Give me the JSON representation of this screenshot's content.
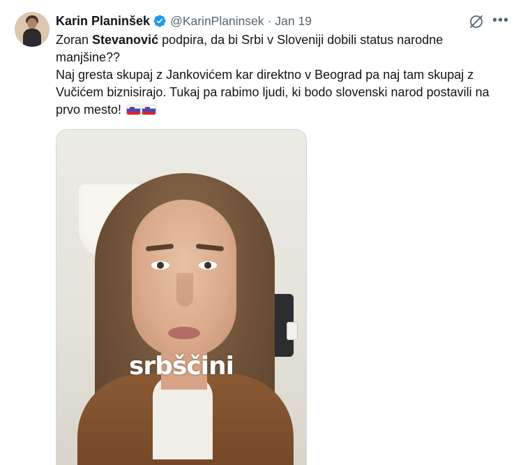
{
  "tweet": {
    "author": {
      "name": "Karin Planinšek",
      "handle": "@KarinPlaninsek",
      "separator": "·",
      "date": "Jan 19"
    },
    "text": {
      "line1_prefix": "Zoran ",
      "line1_bold": "Stevanović",
      "line1_suffix": " podpira, da bi Srbi v Sloveniji dobili status narodne manjšine??",
      "paragraph2": "Naj gresta skupaj z Jankovićem kar direktno v Beograd pa naj tam skupaj z Vučićem biznisirajo. Tukaj pa rabimo ljudi, ki bodo slovenski narod postavili na prvo mesto!",
      "emoji": [
        "flag-slovenia",
        "flag-slovenia"
      ]
    },
    "media": {
      "caption": "srbščini"
    },
    "icons": {
      "verified": "verified-badge-icon",
      "grok": "grok-icon",
      "more": "more-options-icon"
    },
    "colors": {
      "verified": "#1d9bf0",
      "secondary_text": "#536471",
      "primary_text": "#0f1419"
    }
  }
}
